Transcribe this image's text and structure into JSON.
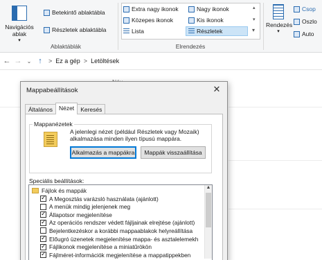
{
  "ribbon": {
    "panes": {
      "navigation_pane": "Navigációs ablak",
      "preview_pane": "Betekintő ablaktábla",
      "details_pane": "Részletek ablaktábla",
      "group_label": "Ablaktáblák"
    },
    "layout": {
      "options": [
        "Extra nagy ikonok",
        "Nagy ikonok",
        "Közepes ikonok",
        "Kis ikonok",
        "Lista",
        "Részletek"
      ],
      "selected": "Részletek",
      "group_label": "Elrendezés"
    },
    "sort": {
      "label": "Rendezés"
    },
    "current_view": {
      "group_by": "Csop",
      "add_columns": "Oszlo",
      "auto_size": "Auto"
    }
  },
  "address": {
    "separator": ">",
    "crumbs": [
      "Ez a gép",
      "Letöltések"
    ]
  },
  "background": {
    "column_header": "Név"
  },
  "dialog": {
    "title": "Mappabeállítások",
    "tabs": [
      "Általános",
      "Nézet",
      "Keresés"
    ],
    "active_tab": "Nézet",
    "folder_views": {
      "title": "Mappanézetek",
      "description": "A jelenlegi nézet (például Részletek vagy Mozaik) alkalmazása minden ilyen típusú mappára.",
      "apply_button": "Alkalmazás a mappákra",
      "reset_button": "Mappák visszaállítása"
    },
    "advanced": {
      "label": "Speciális beállítások:",
      "root": "Fájlok és mappák",
      "items": [
        {
          "label": "A Megosztás varázsló használata (ajánlott)",
          "checked": true
        },
        {
          "label": "A menük mindig jelenjenek meg",
          "checked": false
        },
        {
          "label": "Állapotsor megjelenítése",
          "checked": true
        },
        {
          "label": "Az operációs rendszer védett fájljainak elrejtése (ajánlott)",
          "checked": true
        },
        {
          "label": "Bejelentkezéskor a korábbi mappaablakok helyreállítása",
          "checked": false
        },
        {
          "label": "Előugró üzenetek megjelenítése mappa- és asztalelemekh",
          "checked": true
        },
        {
          "label": "Fájlikonok megjelenítése a miniatűrökön",
          "checked": true
        },
        {
          "label": "Fájlméret-információk megjelenítése a mappatippekben",
          "checked": true
        }
      ]
    }
  }
}
